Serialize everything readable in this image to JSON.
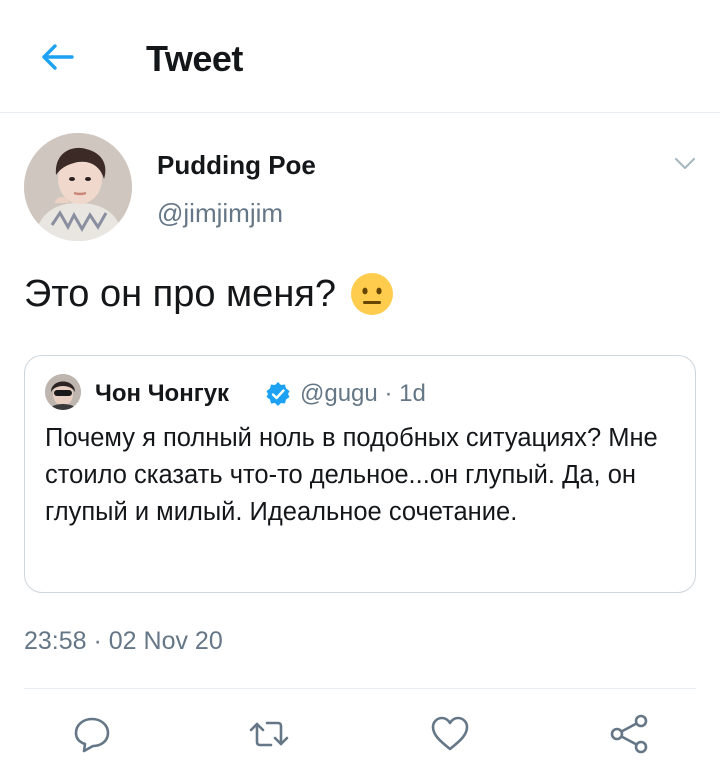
{
  "header": {
    "title": "Tweet",
    "back_icon": "arrow-left-icon",
    "accent": "#1da1f2"
  },
  "author": {
    "name": "Pudding Poe",
    "handle": "@jimjimjim"
  },
  "tweet": {
    "text": "Это он про меня?",
    "emoji": "neutral-face"
  },
  "quoted_tweet": {
    "name": "Чон Чонгук",
    "verified": true,
    "handle": "@gugu",
    "time": "1d",
    "text": "Почему я полный ноль в подобных ситуациях? Мне стоило сказать что-то дельное...он глупый. Да, он глупый и милый. Идеальное сочетание."
  },
  "timestamp": "23:58 · 02 Nov 20",
  "actions": [
    "reply-icon",
    "retweet-icon",
    "like-icon",
    "share-icon"
  ]
}
